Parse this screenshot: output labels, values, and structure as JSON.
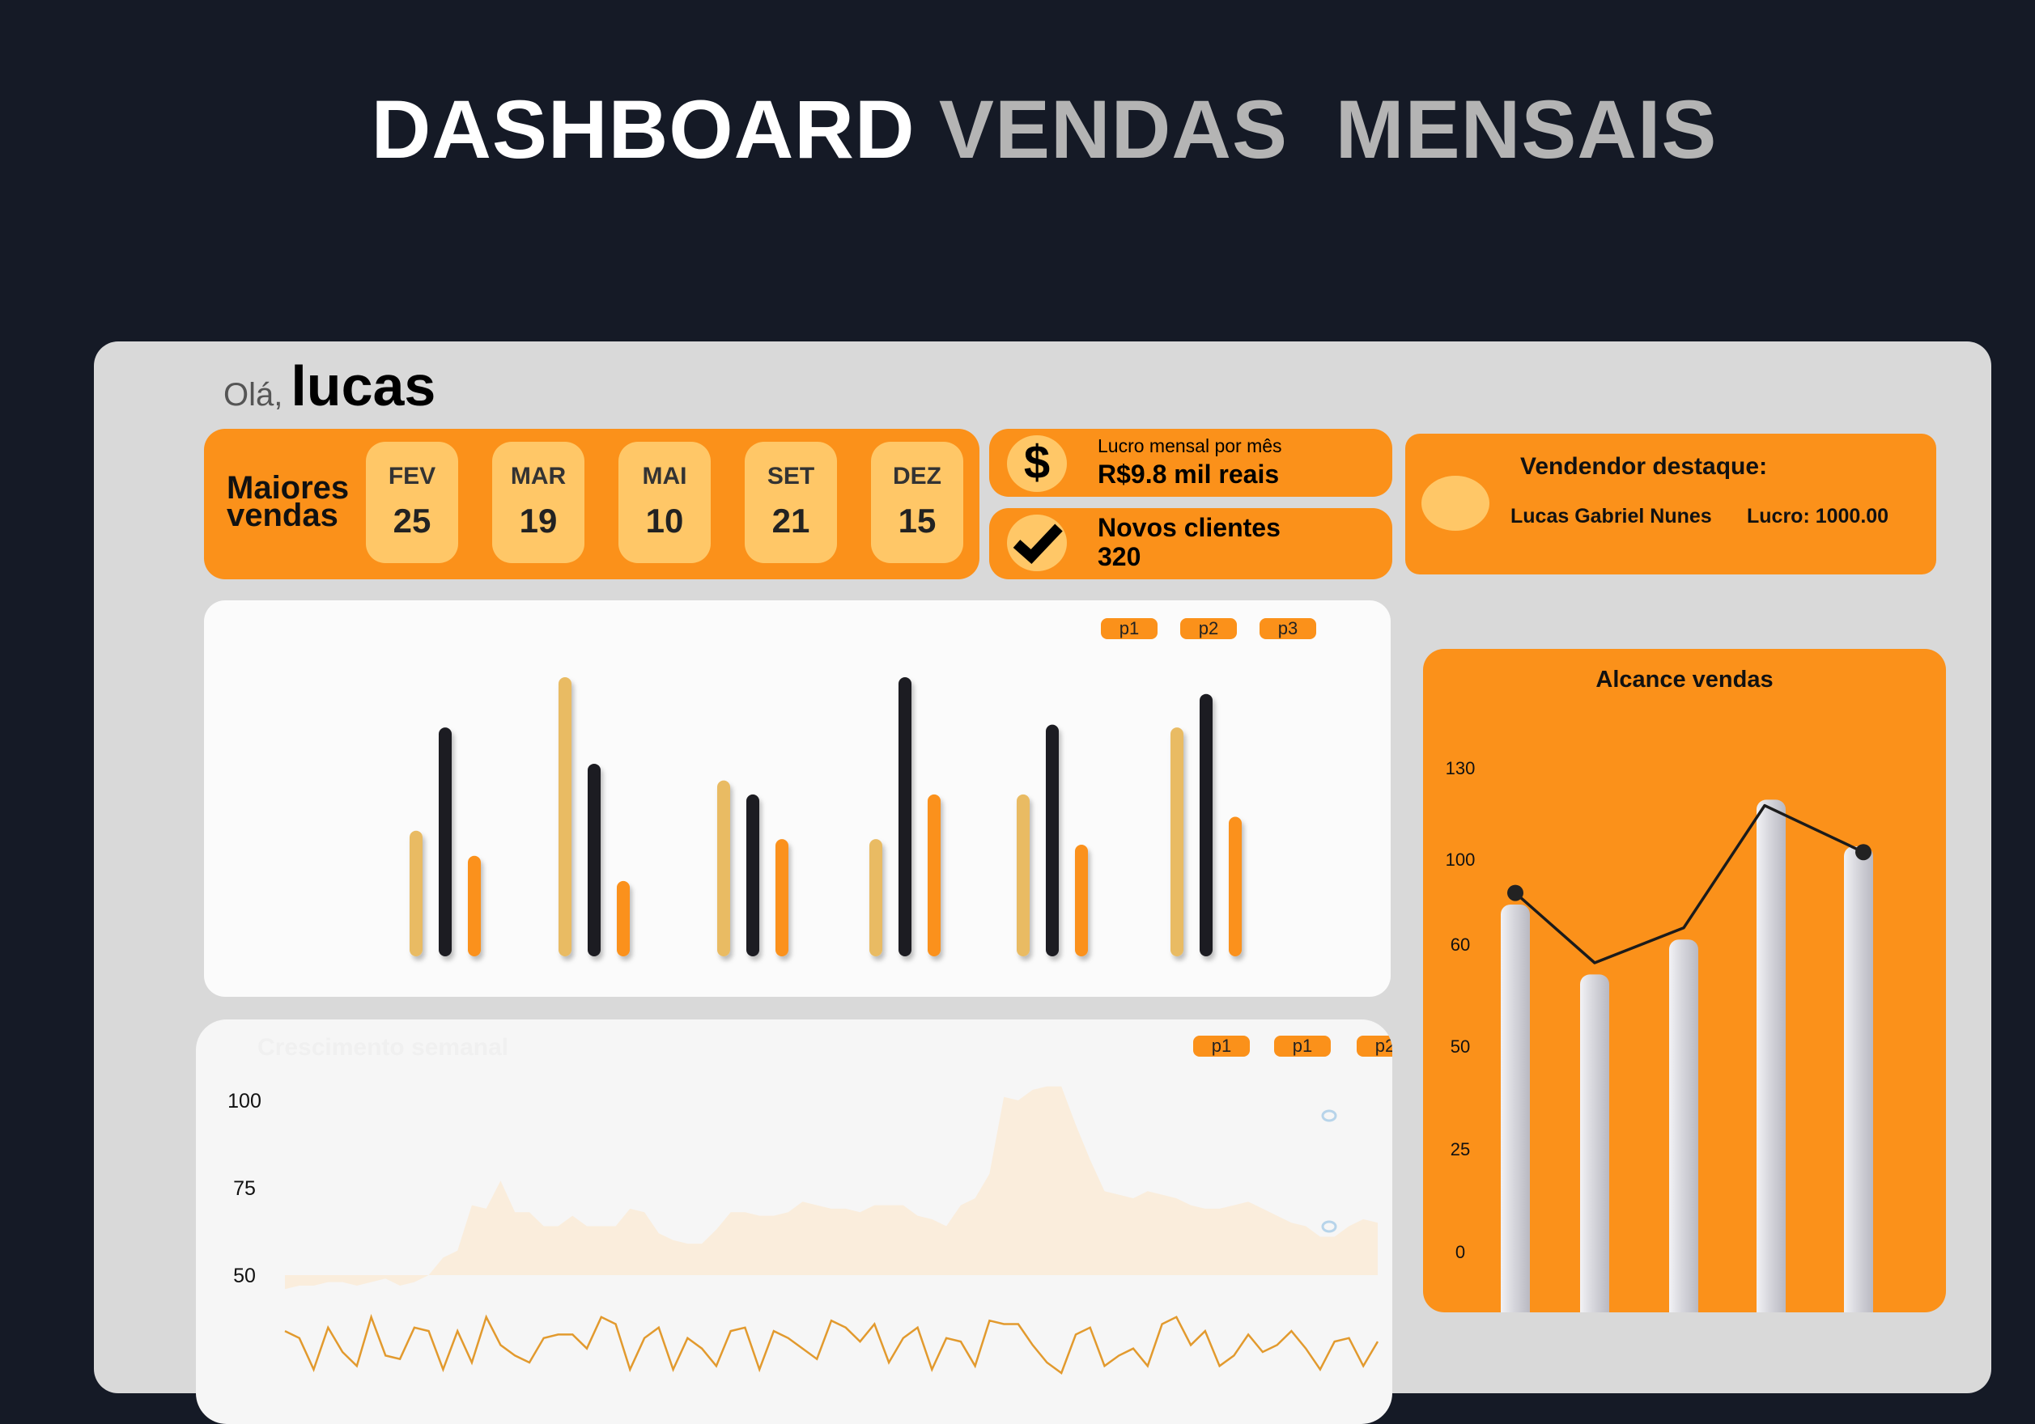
{
  "header": {
    "title_part1": "DASHBOARD",
    "title_part2": "VENDAS  MENSAIS"
  },
  "greeting": {
    "hello": "Olá,",
    "name": "lucas"
  },
  "best_months": {
    "label_line1": "Maiores",
    "label_line2": "vendas",
    "months": [
      {
        "month": "FEV",
        "value": "25"
      },
      {
        "month": "MAR",
        "value": "19"
      },
      {
        "month": "MAI",
        "value": "10"
      },
      {
        "month": "SET",
        "value": "21"
      },
      {
        "month": "DEZ",
        "value": "15"
      }
    ]
  },
  "kpis": {
    "profit_label": "Lucro mensal por mês",
    "profit_value": "R$9.8 mil reais",
    "profit_icon": "dollar-icon",
    "clients_label": "Novos clientes",
    "clients_value": "320",
    "clients_icon": "check-icon"
  },
  "top_seller": {
    "title": "Vendendor destaque:",
    "name": "Lucas Gabriel Nunes",
    "profit": "Lucro: 1000.00"
  },
  "colors": {
    "orange": "#fb911a",
    "light_orange": "#ffc767",
    "tan": "#e9bb63",
    "dark": "#1f1f23",
    "background": "#151a26",
    "panel": "#d9d9d9"
  },
  "chart_data": [
    {
      "type": "bar",
      "legend": [
        "p1",
        "p2",
        "p3"
      ],
      "series": [
        {
          "name": "p1",
          "color": "#e9bb63",
          "values": [
            45,
            100,
            63,
            42,
            58,
            82
          ]
        },
        {
          "name": "p2",
          "color": "#1f1f23",
          "values": [
            82,
            69,
            58,
            100,
            83,
            94
          ]
        },
        {
          "name": "p3",
          "color": "#fb911a",
          "values": [
            36,
            27,
            42,
            58,
            40,
            50
          ]
        }
      ],
      "ylim": [
        0,
        100
      ]
    },
    {
      "type": "area",
      "title": "Crescimento semanal",
      "legend": [
        "p1",
        "p1",
        "p2"
      ],
      "yticks": [
        "100",
        "75",
        "50"
      ],
      "ylim": [
        25,
        110
      ],
      "area_values": [
        46,
        47,
        47,
        48,
        48,
        47,
        48,
        49,
        47,
        48,
        50,
        55,
        57,
        70,
        69,
        77,
        68,
        68,
        64,
        64,
        67,
        64,
        64,
        64,
        69,
        68,
        62,
        60,
        59,
        59,
        63,
        68,
        68,
        67,
        67,
        68,
        71,
        70,
        69,
        69,
        68,
        70,
        70,
        70,
        67,
        66,
        64,
        70,
        72,
        79,
        101,
        100,
        103,
        104,
        104,
        93,
        83,
        74,
        73,
        72,
        74,
        73,
        72,
        70,
        69,
        69,
        70,
        71,
        69,
        67,
        65,
        64,
        61,
        61,
        64,
        66,
        65
      ],
      "line_values": [
        34,
        32,
        23,
        35,
        28,
        24,
        38,
        27,
        26,
        35,
        34,
        23,
        34,
        25,
        38,
        30,
        27,
        25,
        32,
        33,
        33,
        29,
        38,
        36,
        23,
        32,
        35,
        23,
        32,
        29,
        24,
        34,
        35,
        23,
        34,
        32,
        29,
        26,
        37,
        35,
        31,
        36,
        25,
        32,
        35,
        23,
        32,
        31,
        24,
        37,
        36,
        36,
        30,
        25,
        22,
        33,
        35,
        24,
        27,
        29,
        24,
        36,
        38,
        30,
        34,
        24,
        27,
        33,
        28,
        30,
        34,
        29,
        23,
        31,
        32,
        24,
        31
      ]
    },
    {
      "type": "bar",
      "title": "Alcance vendas",
      "yticks": [
        "130",
        "100",
        "60",
        "50",
        "25",
        "0"
      ],
      "values": [
        0.7,
        0.58,
        0.64,
        0.88,
        0.8
      ],
      "line_values": [
        0.72,
        0.6,
        0.66,
        0.87,
        0.79
      ],
      "bar_color": "#d4d4dc",
      "line_color": "#1b1b1b"
    }
  ]
}
